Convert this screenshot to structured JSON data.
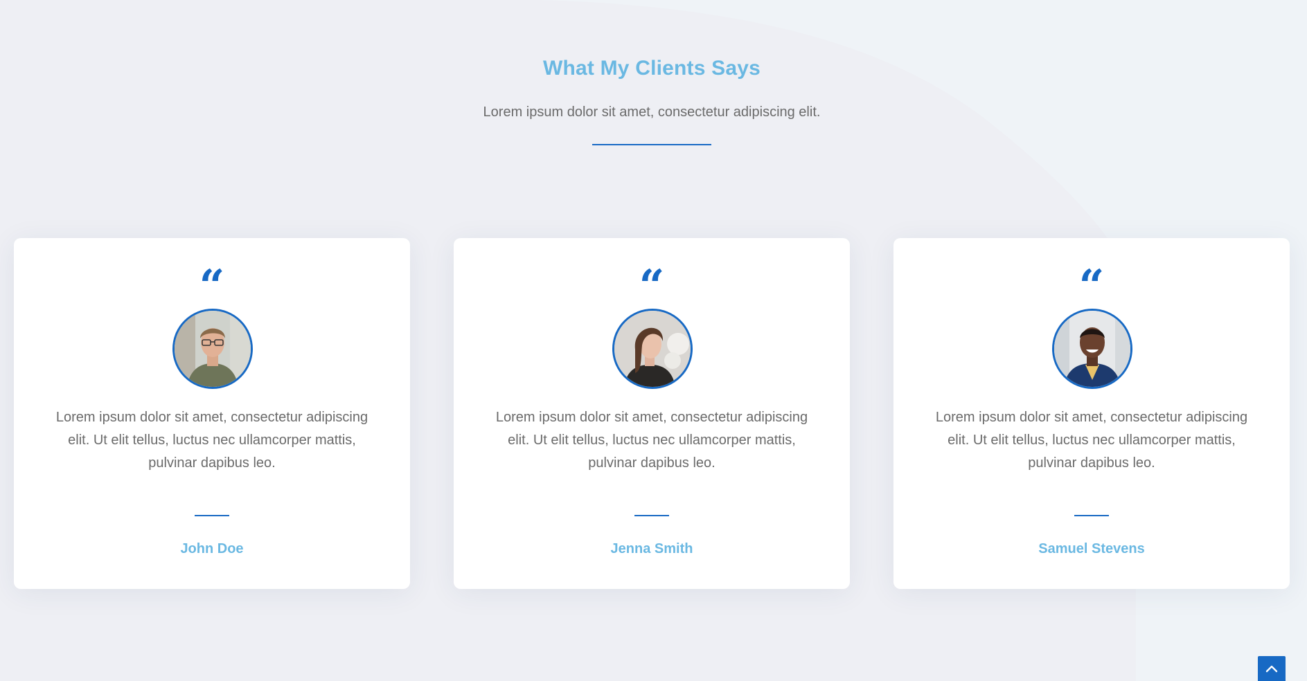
{
  "section": {
    "title": "What My Clients Says",
    "subtitle": "Lorem ipsum dolor sit amet, consectetur adipiscing elit."
  },
  "testimonials": [
    {
      "quote_icon": "“",
      "text": "Lorem ipsum dolor sit amet, consectetur adipiscing elit. Ut elit tellus, luctus nec ullamcorper mattis, pulvinar dapibus leo.",
      "name": "John Doe"
    },
    {
      "quote_icon": "“",
      "text": "Lorem ipsum dolor sit amet, consectetur adipiscing elit. Ut elit tellus, luctus nec ullamcorper mattis, pulvinar dapibus leo.",
      "name": "Jenna Smith"
    },
    {
      "quote_icon": "“",
      "text": "Lorem ipsum dolor sit amet, consectetur adipiscing elit. Ut elit tellus, luctus nec ullamcorper mattis, pulvinar dapibus leo.",
      "name": "Samuel Stevens"
    }
  ],
  "icons": {
    "quote": "quote-icon",
    "scroll_top": "chevron-up-icon"
  },
  "colors": {
    "accent": "#1769c4",
    "title": "#6ab8e2",
    "text": "#6a6a6a",
    "background": "#eff3f7",
    "card": "#ffffff"
  }
}
